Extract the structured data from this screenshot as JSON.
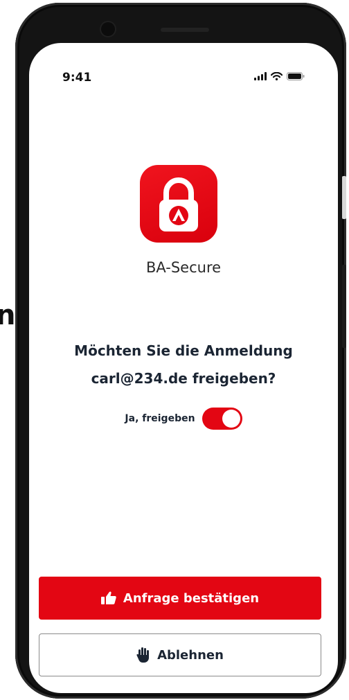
{
  "background": {
    "fragment_text": "ng"
  },
  "status_bar": {
    "time": "9:41",
    "icons": [
      "cellular-signal-icon",
      "wifi-icon",
      "battery-icon"
    ]
  },
  "app": {
    "name": "BA-Secure",
    "icon": "padlock-app-icon"
  },
  "prompt": {
    "line1": "Möchten Sie die Anmeldung",
    "line2": "carl@234.de freigeben?"
  },
  "toggle": {
    "label": "Ja, freigeben",
    "state": "on"
  },
  "buttons": {
    "confirm": {
      "label": "Anfrage bestätigen",
      "icon": "thumbs-up-icon"
    },
    "reject": {
      "label": "Ablehnen",
      "icon": "stop-hand-icon"
    }
  },
  "colors": {
    "accent": "#e30613",
    "text": "#1b2533"
  }
}
